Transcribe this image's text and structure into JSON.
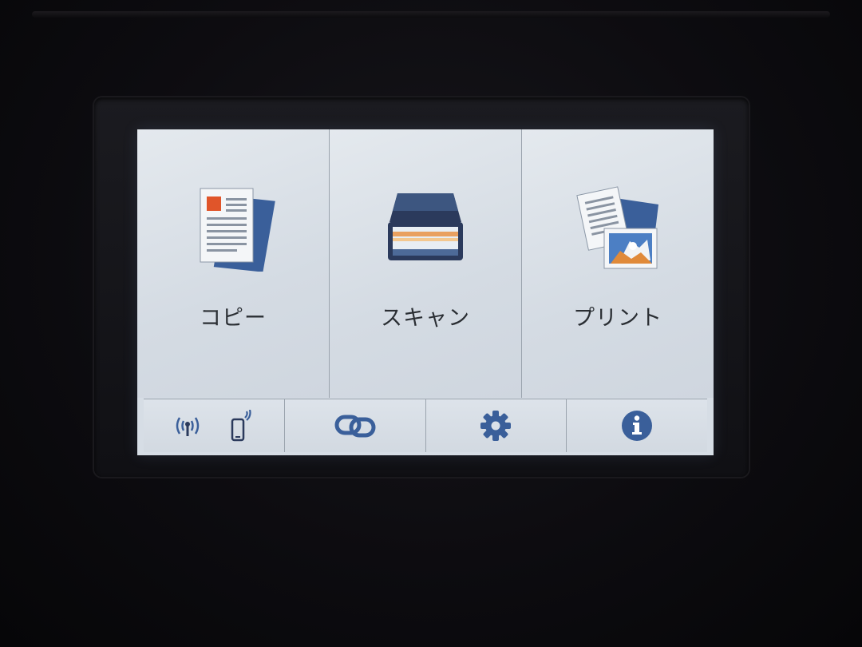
{
  "tiles": [
    {
      "id": "copy",
      "label": "コピー",
      "icon": "copy-document-icon"
    },
    {
      "id": "scan",
      "label": "スキャン",
      "icon": "scanner-icon"
    },
    {
      "id": "print",
      "label": "プリント",
      "icon": "print-photo-icon"
    }
  ],
  "bottom_bar": [
    {
      "id": "wireless",
      "icons": [
        "wifi-antenna-icon",
        "mobile-device-icon"
      ]
    },
    {
      "id": "connect",
      "icons": [
        "chain-link-icon"
      ]
    },
    {
      "id": "settings",
      "icons": [
        "gear-icon"
      ]
    },
    {
      "id": "info",
      "icons": [
        "info-icon"
      ]
    }
  ],
  "colors": {
    "icon_blue": "#3a5f9a",
    "icon_navy": "#2b3a5c",
    "accent_orange": "#e0552a",
    "screen_bg": "#d6dde5",
    "label_text": "#2a2e33"
  }
}
